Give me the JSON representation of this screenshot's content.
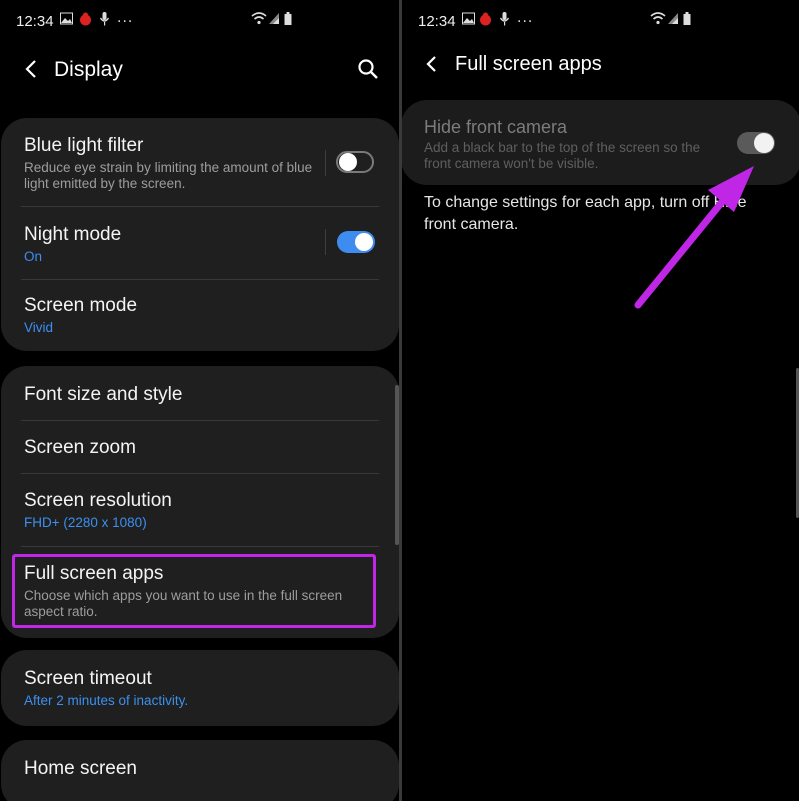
{
  "status_bar": {
    "time": "12:34",
    "more": "..."
  },
  "left": {
    "header": {
      "title": "Display"
    },
    "card1": [
      {
        "title": "Blue light filter",
        "subtitle": "Reduce eye strain by limiting the amount of blue light emitted by the screen.",
        "toggle": "off"
      },
      {
        "title": "Night mode",
        "subtitle": "On",
        "toggle": "on"
      },
      {
        "title": "Screen mode",
        "subtitle": "Vivid"
      }
    ],
    "card2": [
      {
        "title": "Font size and style"
      },
      {
        "title": "Screen zoom"
      },
      {
        "title": "Screen resolution",
        "subtitle": "FHD+ (2280 x 1080)"
      },
      {
        "title": "Full screen apps",
        "subtitle": "Choose which apps you want to use in the full screen aspect ratio."
      }
    ],
    "card3": {
      "title": "Screen timeout",
      "subtitle": "After 2 minutes of inactivity."
    },
    "card4": {
      "title": "Home screen"
    }
  },
  "right": {
    "header": {
      "title": "Full screen apps"
    },
    "hide_camera": {
      "title": "Hide front camera",
      "subtitle": "Add a black bar to the top of the screen so the front camera won't be visible.",
      "toggle": "on"
    },
    "note": "To change settings for each app, turn off Hide front camera."
  },
  "colors": {
    "accent_blue": "#3f8cf0",
    "highlight_purple": "#c026e6",
    "card_bg": "#1f1f1f"
  }
}
